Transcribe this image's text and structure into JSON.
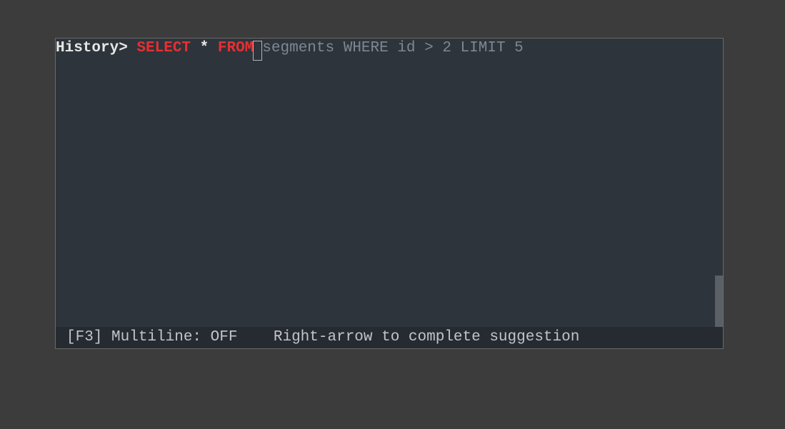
{
  "terminal": {
    "prompt": "History> ",
    "typed": {
      "select": "SELECT",
      "sep1": " ",
      "star": "*",
      "sep2": " ",
      "from": "FROM"
    },
    "suggestion": "segments WHERE id > 2 LIMIT 5"
  },
  "status": {
    "multiline": "[F3] Multiline: OFF",
    "gap": "    ",
    "hint": "Right-arrow to complete suggestion"
  }
}
